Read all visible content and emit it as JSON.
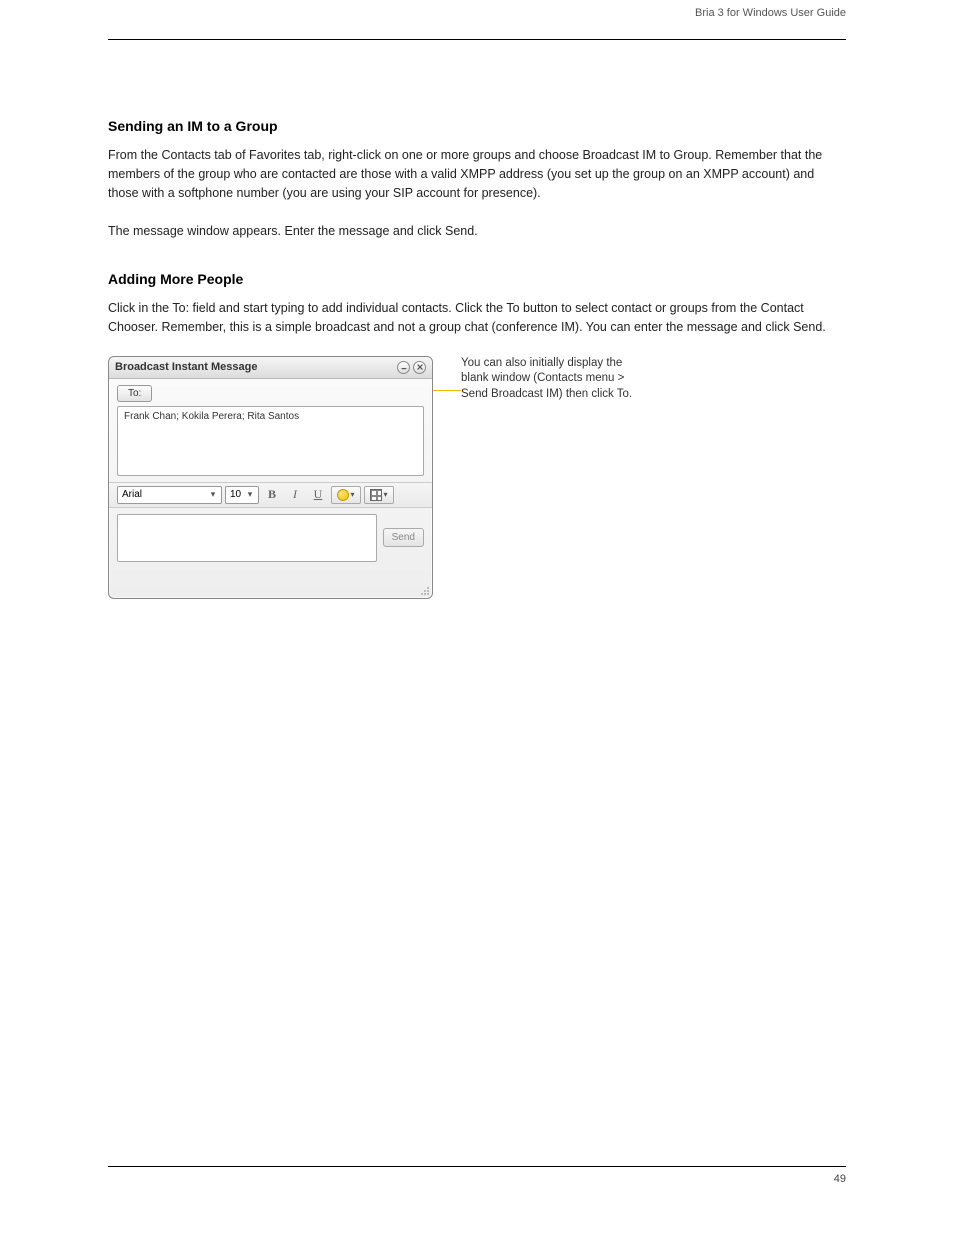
{
  "header": {
    "right": "Bria 3 for Windows User Guide"
  },
  "sections": {
    "sending": {
      "heading": "Sending an IM to a Group",
      "para1": "From the Contacts tab of Favorites tab, right-click on one or more groups and choose Broadcast IM to Group. Remember that the members of the group who are contacted are those with a valid XMPP address (you set up the group on an XMPP account) and those with a softphone number (you are using your SIP account for presence).",
      "para2": "The message window appears. Enter the message and click Send."
    },
    "dialog": {
      "heading": "Adding More People",
      "para": "Click in the To: field and start typing to add individual contacts. Click the To button to select contact or groups from the Contact Chooser. Remember, this is a simple broadcast and not a group chat (conference IM). You can enter the message and click Send."
    }
  },
  "callout": {
    "text_line1": "You can also initially display the",
    "text_line2": "blank window (Contacts menu >",
    "text_line3": "Send Broadcast IM) then click To."
  },
  "window": {
    "title": "Broadcast Instant Message",
    "to_label": "To:",
    "recipients": "Frank Chan; Kokila Perera; Rita Santos",
    "font": "Arial",
    "size": "10",
    "send": "Send"
  },
  "footer": {
    "left": "",
    "right": "49"
  }
}
